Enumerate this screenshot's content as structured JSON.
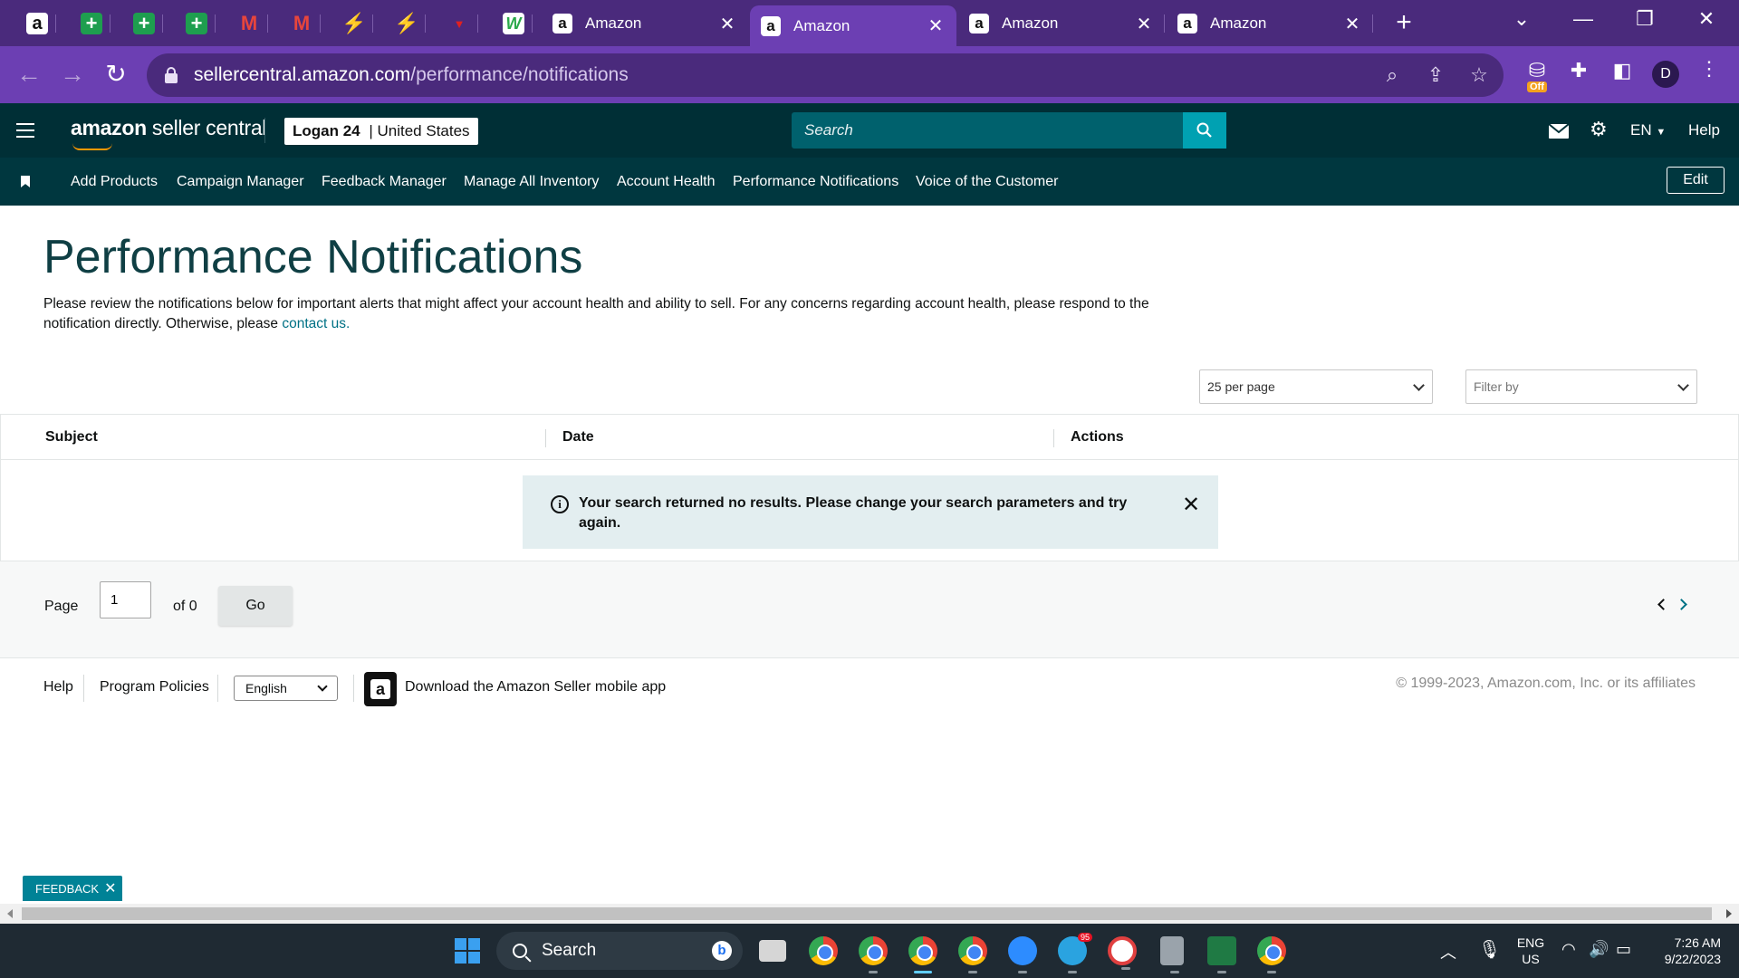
{
  "browser": {
    "tabs": [
      {
        "title": "Amazon",
        "active": false
      },
      {
        "title": "Amazon",
        "active": true
      },
      {
        "title": "Amazon",
        "active": false
      },
      {
        "title": "Amazon",
        "active": false
      }
    ],
    "pinned_icons": [
      "amazon-icon",
      "sheets-icon",
      "sheets-icon",
      "sheets-icon",
      "gmail-icon",
      "gmail-icon",
      "orange-app-icon",
      "orange-app-icon",
      "red-app-icon",
      "green-w-icon"
    ],
    "url_domain": "sellercentral.amazon.com",
    "url_path": "/performance/notifications",
    "extension_badge": "Off",
    "profile_initial": "D",
    "accent_color": "#6c3fb3"
  },
  "header": {
    "logo_bold": "amazon",
    "logo_rest": " seller central",
    "account_name": "Logan 24",
    "account_separator": " | ",
    "account_region": "United States",
    "search_placeholder": "Search",
    "language": "EN",
    "help_label": "Help"
  },
  "bookmarks": {
    "items": [
      "Add Products",
      "Campaign Manager",
      "Feedback Manager",
      "Manage All Inventory",
      "Account Health",
      "Performance Notifications",
      "Voice of the Customer"
    ],
    "edit_label": "Edit"
  },
  "main": {
    "title": "Performance Notifications",
    "intro_text": "Please review the notifications below for important alerts that might affect your account health and ability to sell. For any concerns regarding account health, please respond to the notification directly. Otherwise, please ",
    "contact_link": "contact us.",
    "per_page": "25 per page",
    "filter_placeholder": "Filter by",
    "columns": [
      "Subject",
      "Date",
      "Actions"
    ],
    "alert_message": "Your search returned no results. Please change your search parameters and try again.",
    "pager": {
      "page_label": "Page",
      "page_value": "1",
      "of_label": "of 0",
      "go_label": "Go"
    }
  },
  "footer": {
    "help": "Help",
    "policies": "Program Policies",
    "language": "English",
    "app_text": "Download the Amazon Seller mobile app",
    "copyright": "© 1999-2023, Amazon.com, Inc. or its affiliates"
  },
  "feedback_label": "FEEDBACK",
  "taskbar": {
    "search_label": "Search",
    "lang_top": "ENG",
    "lang_bottom": "US",
    "time": "7:26 AM",
    "date": "9/22/2023",
    "telegram_badge": "95"
  }
}
